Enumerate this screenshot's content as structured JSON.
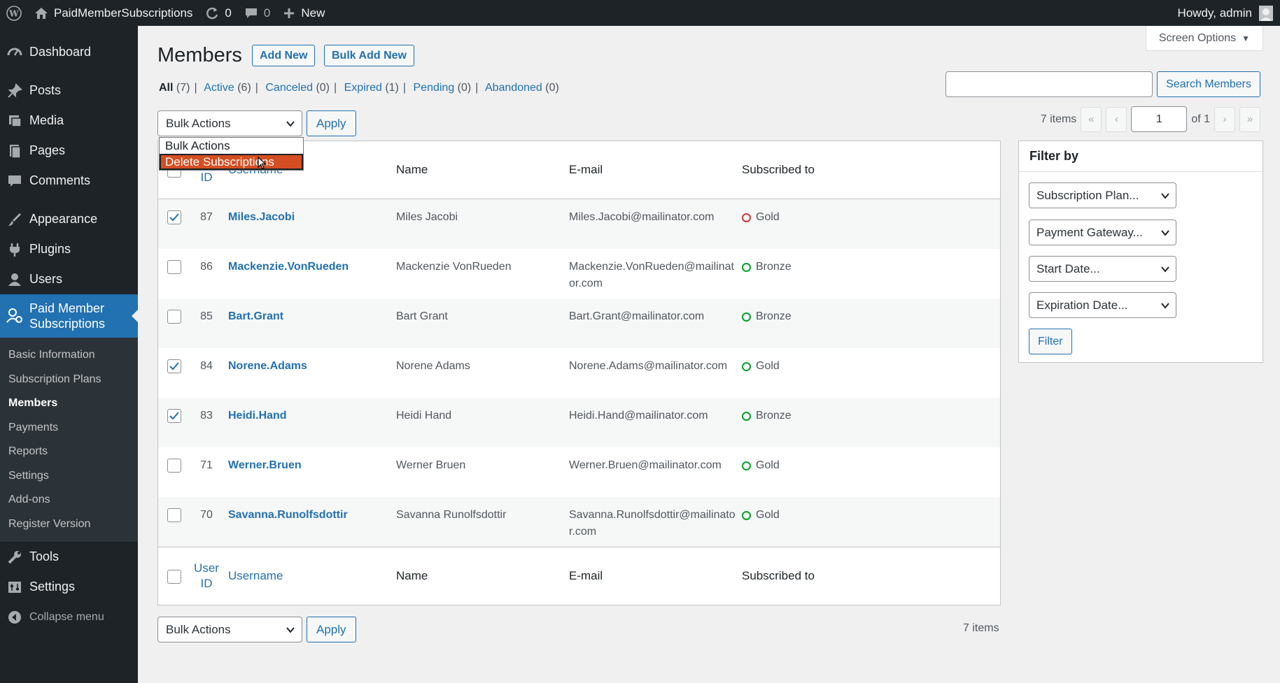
{
  "admin_bar": {
    "site_name": "PaidMemberSubscriptions",
    "updates_count": "0",
    "comments_count": "0",
    "new_label": "New",
    "howdy": "Howdy, admin"
  },
  "sidebar": {
    "items": [
      {
        "label": "Dashboard",
        "icon": "dashboard-icon"
      },
      {
        "label": "Posts",
        "icon": "pin-icon"
      },
      {
        "label": "Media",
        "icon": "media-icon"
      },
      {
        "label": "Pages",
        "icon": "pages-icon"
      },
      {
        "label": "Comments",
        "icon": "comment-icon"
      },
      {
        "label": "Appearance",
        "icon": "brush-icon"
      },
      {
        "label": "Plugins",
        "icon": "plugin-icon"
      },
      {
        "label": "Users",
        "icon": "user-icon"
      }
    ],
    "current": {
      "label_line1": "Paid Member",
      "label_line2": "Subscriptions"
    },
    "submenu": [
      "Basic Information",
      "Subscription Plans",
      "Members",
      "Payments",
      "Reports",
      "Settings",
      "Add-ons",
      "Register Version"
    ],
    "after": [
      {
        "label": "Tools",
        "icon": "wrench-icon"
      },
      {
        "label": "Settings",
        "icon": "settings-icon"
      }
    ],
    "collapse_label": "Collapse menu"
  },
  "header": {
    "title": "Members",
    "add_new": "Add New",
    "bulk_add_new": "Bulk Add New",
    "screen_options": "Screen Options"
  },
  "views": {
    "all": "All",
    "all_count": "(7)",
    "active": "Active",
    "active_count": "(6)",
    "canceled": "Canceled",
    "canceled_count": "(0)",
    "expired": "Expired",
    "expired_count": "(1)",
    "pending": "Pending",
    "pending_count": "(0)",
    "abandoned": "Abandoned",
    "abandoned_count": "(0)"
  },
  "search": {
    "button": "Search Members",
    "value": ""
  },
  "bulk": {
    "selected": "Bulk Actions",
    "apply": "Apply",
    "options": [
      "Bulk Actions",
      "Delete Subscriptions"
    ]
  },
  "pagination": {
    "items": "7 items",
    "first": "«",
    "prev": "‹",
    "next": "›",
    "last": "»",
    "current_page": "1",
    "of_pages": "of 1"
  },
  "table": {
    "columns": {
      "user_id_1": "User",
      "user_id_2": "ID",
      "username": "Username",
      "name": "Name",
      "email": "E-mail",
      "subscribed": "Subscribed to"
    },
    "rows": [
      {
        "id": "87",
        "username": "Miles.Jacobi",
        "name": "Miles Jacobi",
        "email": "Miles.Jacobi@mailinator.com",
        "plan": "Gold",
        "checked": true,
        "status": "expired"
      },
      {
        "id": "86",
        "username": "Mackenzie.VonRueden",
        "name": "Mackenzie VonRueden",
        "email": "Mackenzie.VonRueden@mailinator.com",
        "plan": "Bronze",
        "checked": false,
        "status": "active"
      },
      {
        "id": "85",
        "username": "Bart.Grant",
        "name": "Bart Grant",
        "email": "Bart.Grant@mailinator.com",
        "plan": "Bronze",
        "checked": false,
        "status": "active"
      },
      {
        "id": "84",
        "username": "Norene.Adams",
        "name": "Norene Adams",
        "email": "Norene.Adams@mailinator.com",
        "plan": "Gold",
        "checked": true,
        "status": "active"
      },
      {
        "id": "83",
        "username": "Heidi.Hand",
        "name": "Heidi Hand",
        "email": "Heidi.Hand@mailinator.com",
        "plan": "Bronze",
        "checked": true,
        "status": "active"
      },
      {
        "id": "71",
        "username": "Werner.Bruen",
        "name": "Werner Bruen",
        "email": "Werner.Bruen@mailinator.com",
        "plan": "Gold",
        "checked": false,
        "status": "active"
      },
      {
        "id": "70",
        "username": "Savanna.Runolfsdottir",
        "name": "Savanna Runolfsdottir",
        "email": "Savanna.Runolfsdottir@mailinator.com",
        "plan": "Gold",
        "checked": false,
        "status": "active"
      }
    ]
  },
  "filter": {
    "title": "Filter by",
    "subscription_plan": "Subscription Plan...",
    "payment_gateway": "Payment Gateway...",
    "start_date": "Start Date...",
    "expiration_date": "Expiration Date...",
    "button": "Filter"
  },
  "colors": {
    "accent": "#2271b1",
    "highlight": "#d54e21",
    "active": "#00a32a",
    "expired": "#d63638"
  }
}
